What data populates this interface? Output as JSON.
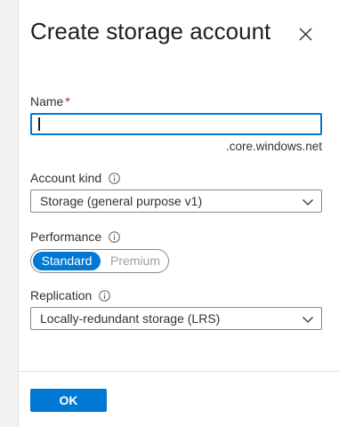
{
  "dialog": {
    "title": "Create storage account",
    "close_icon": "close-icon"
  },
  "name_field": {
    "label": "Name",
    "required_marker": "*",
    "value": "",
    "placeholder": "",
    "suffix": ".core.windows.net"
  },
  "account_kind": {
    "label": "Account kind",
    "info_icon": "info-icon",
    "selected": "Storage (general purpose v1)"
  },
  "performance": {
    "label": "Performance",
    "info_icon": "info-icon",
    "options": [
      "Standard",
      "Premium"
    ],
    "selected": "Standard"
  },
  "replication": {
    "label": "Replication",
    "info_icon": "info-icon",
    "selected": "Locally-redundant storage (LRS)"
  },
  "footer": {
    "ok_label": "OK"
  },
  "colors": {
    "accent": "#0078d4",
    "required": "#a4262c",
    "border": "#8a8886",
    "disabled_text": "#a19f9d"
  }
}
